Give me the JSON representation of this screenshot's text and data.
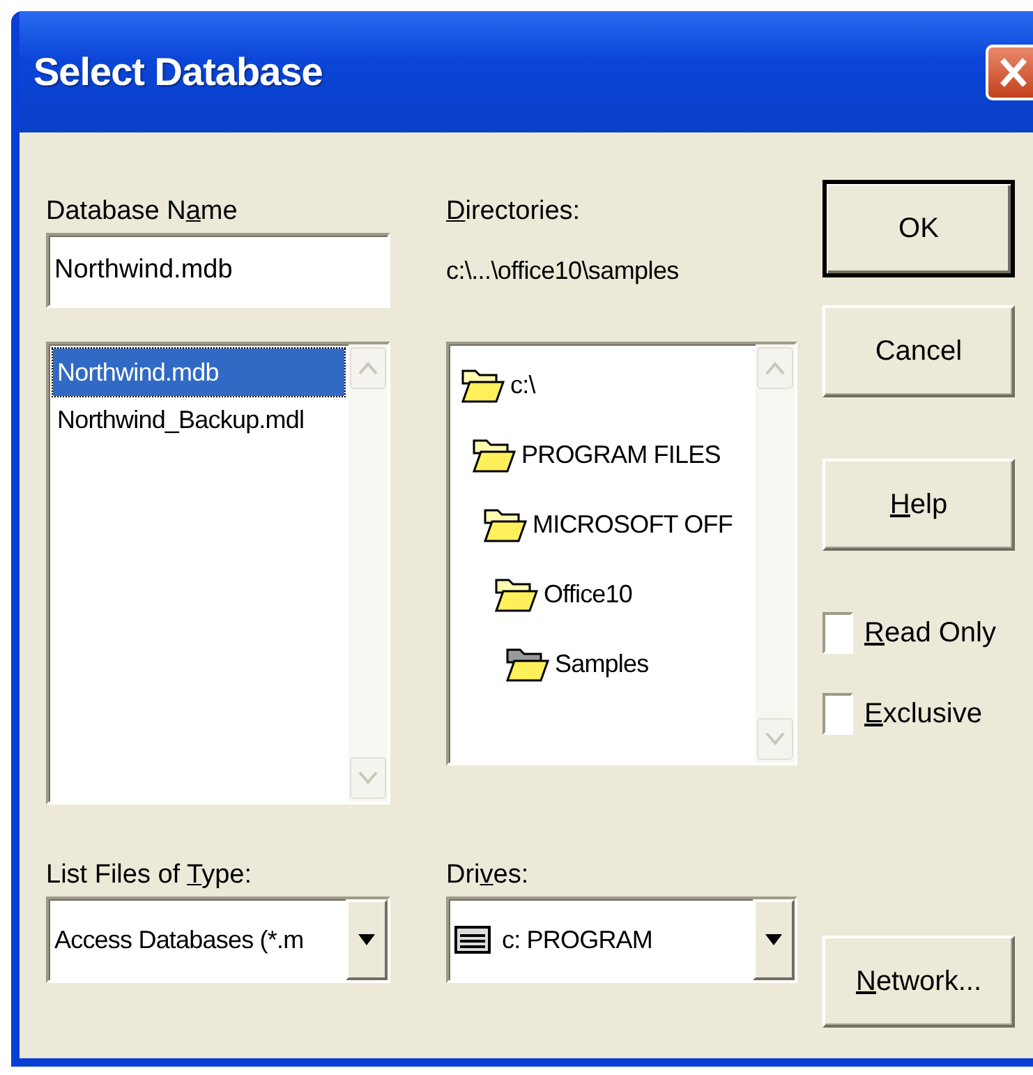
{
  "window": {
    "title": "Select Database"
  },
  "database_name": {
    "label": {
      "before": "Database N",
      "key": "a",
      "after": "me"
    },
    "value": "Northwind.mdb"
  },
  "files": [
    {
      "name": "Northwind.mdb",
      "selected": true
    },
    {
      "name": "Northwind_Backup.mdl",
      "selected": false
    }
  ],
  "directories": {
    "label": {
      "key": "D",
      "after": "irectories:"
    },
    "path": "c:\\...\\office10\\samples",
    "tree": [
      {
        "name": "c:\\",
        "open": true,
        "children": [
          {
            "name": "PROGRAM FILES",
            "open": true,
            "children": [
              {
                "name": "MICROSOFT OFF",
                "open": true,
                "children": [
                  {
                    "name": "Office10",
                    "open": true,
                    "children": [
                      {
                        "name": "Samples",
                        "open": false
                      }
                    ]
                  }
                ]
              }
            ]
          }
        ]
      }
    ]
  },
  "buttons": [
    {
      "label": {
        "before": "OK"
      },
      "default": true
    },
    {
      "label": {
        "before": "Cancel"
      },
      "default": false
    },
    {
      "label": {
        "key": "H",
        "after": "elp"
      },
      "default": false
    }
  ],
  "options": [
    {
      "label": {
        "key": "R",
        "after": "ead Only"
      },
      "checked": false
    },
    {
      "label": {
        "key": "E",
        "after": "xclusive"
      },
      "checked": false
    }
  ],
  "file_type": {
    "label": {
      "before": "List Files of ",
      "key": "T",
      "after": "ype:"
    },
    "value": "Access Databases (*.m"
  },
  "drives": {
    "label": {
      "before": "Dri",
      "key": "v",
      "after": "es:"
    },
    "value": "c: PROGRAM"
  },
  "network_button": {
    "label": {
      "key": "N",
      "after": "etwork..."
    }
  }
}
